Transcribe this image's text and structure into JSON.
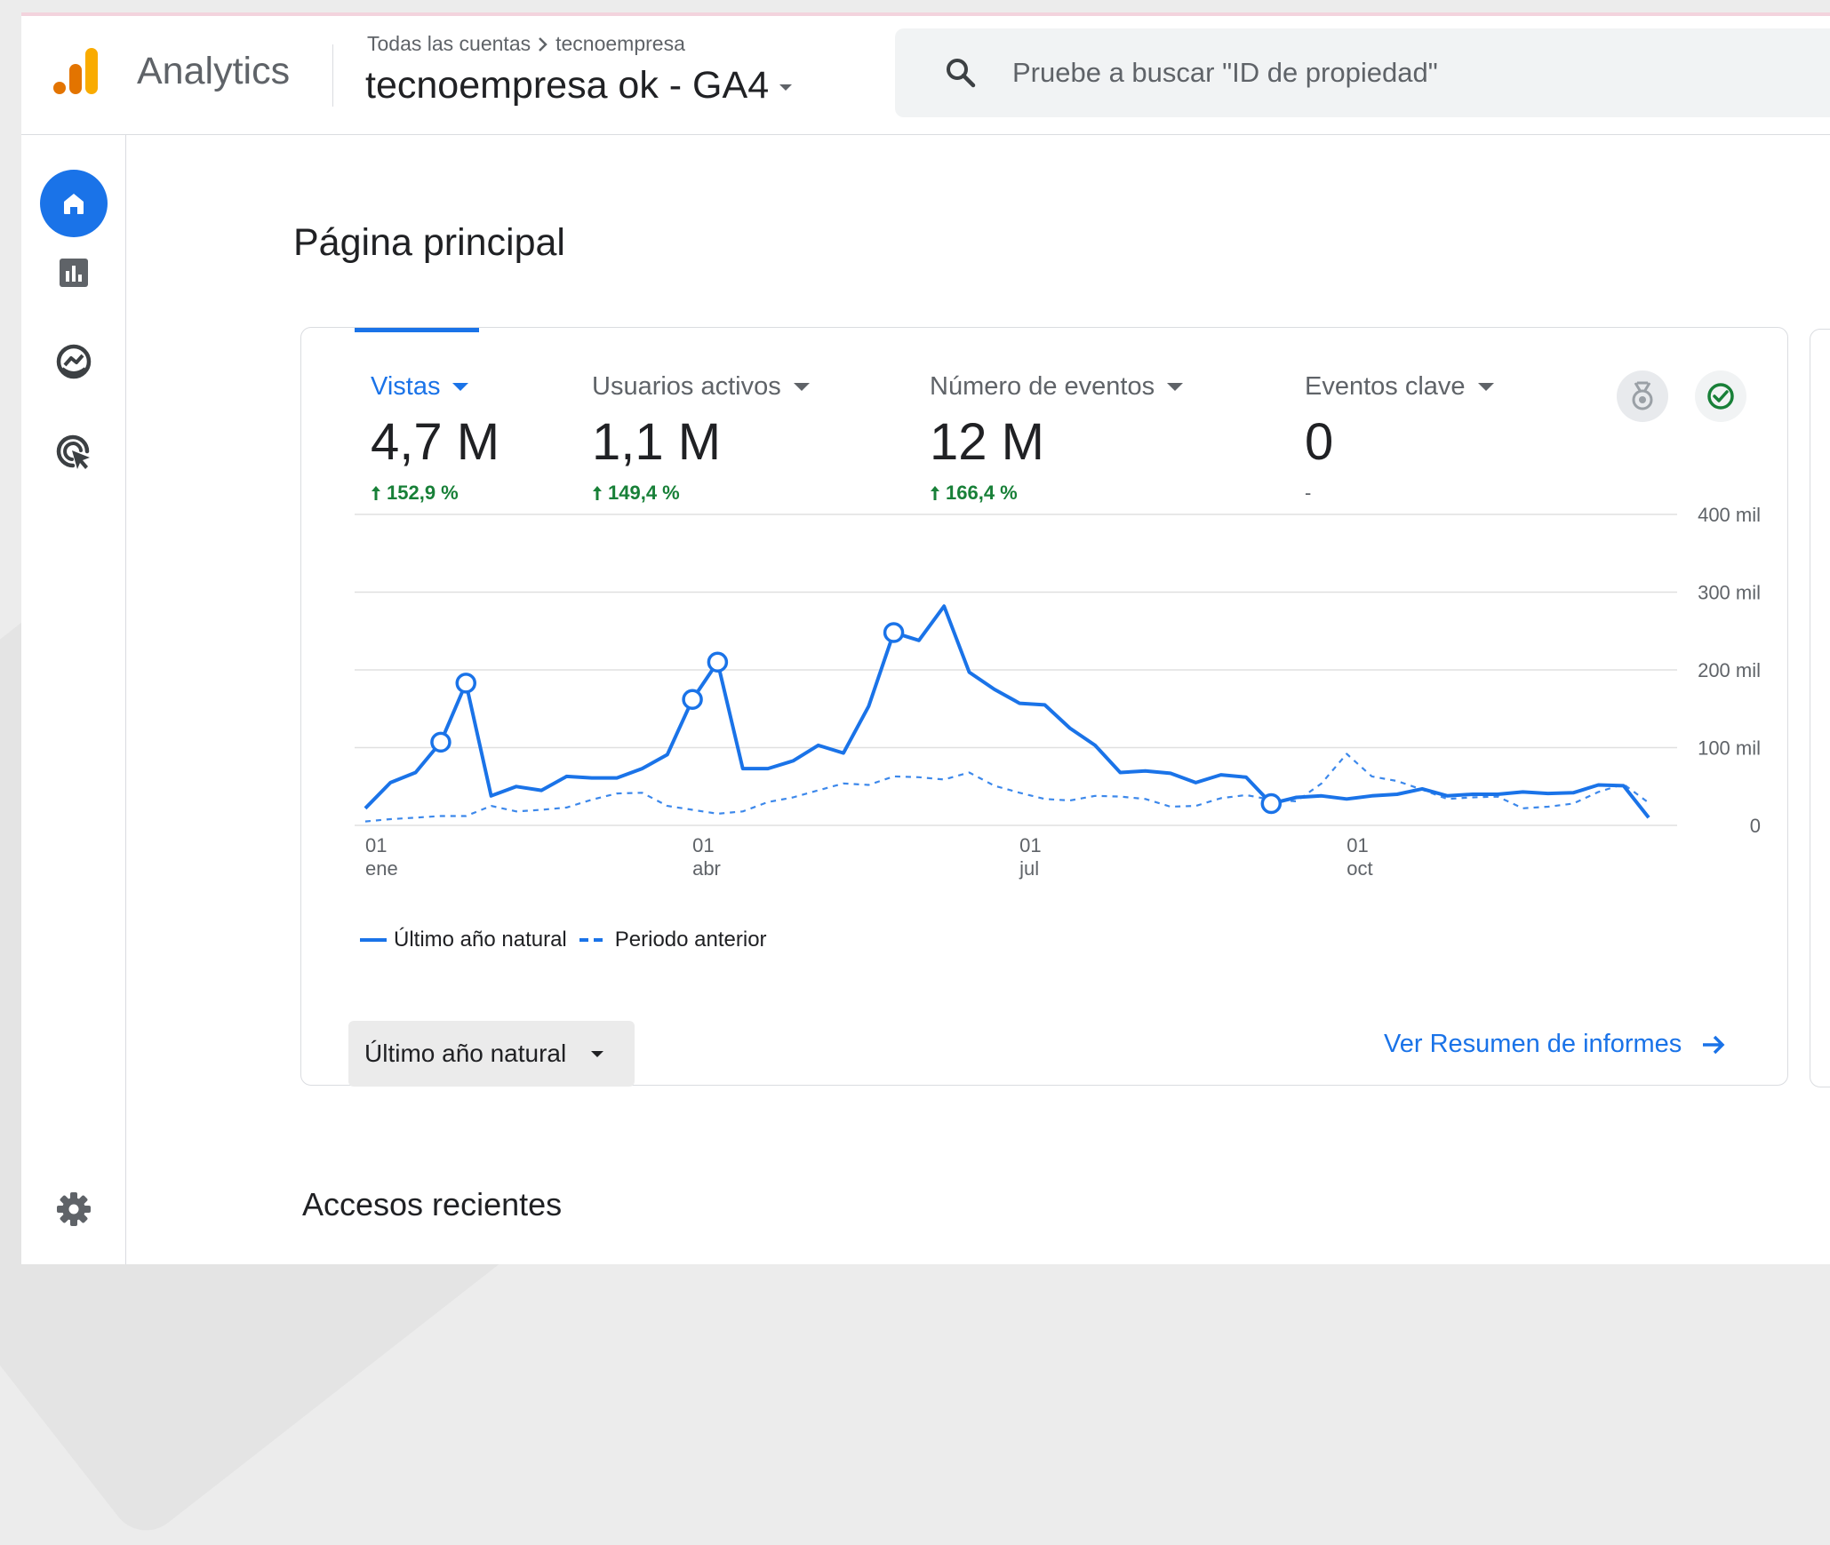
{
  "header": {
    "app_title": "Analytics",
    "breadcrumb": {
      "all_accounts": "Todas las cuentas",
      "account": "tecnoempresa"
    },
    "property": "tecnoempresa ok - GA4",
    "search_placeholder": "Pruebe a buscar \"ID de propiedad\""
  },
  "sidebar": {
    "items": [
      {
        "icon": "home-icon",
        "active": true
      },
      {
        "icon": "reports-icon"
      },
      {
        "icon": "explore-icon"
      },
      {
        "icon": "advertising-icon"
      }
    ],
    "settings_icon": "gear-icon"
  },
  "main": {
    "page_title": "Página principal",
    "metrics": [
      {
        "label": "Vistas",
        "value": "4,7 M",
        "change": "152,9 %",
        "active": true
      },
      {
        "label": "Usuarios activos",
        "value": "1,1 M",
        "change": "149,4 %"
      },
      {
        "label": "Número de eventos",
        "value": "12 M",
        "change": "166,4 %"
      },
      {
        "label": "Eventos clave",
        "value": "0",
        "change": "-"
      }
    ],
    "range_button": "Último año natural",
    "report_link": "Ver Resumen de informes",
    "recent_title": "Accesos recientes"
  },
  "colors": {
    "accent": "#1a73e8",
    "positive": "#188038",
    "insight_check": "#188038"
  },
  "chart_data": {
    "type": "line",
    "y_ticks": [
      "400 mil",
      "300 mil",
      "200 mil",
      "100 mil",
      "0"
    ],
    "ylim": [
      0,
      400000
    ],
    "x_ticks": [
      {
        "day": "01",
        "month": "ene",
        "index": 0
      },
      {
        "day": "01",
        "month": "abr",
        "index": 13
      },
      {
        "day": "01",
        "month": "jul",
        "index": 26
      },
      {
        "day": "01",
        "month": "oct",
        "index": 39
      }
    ],
    "series": [
      {
        "name": "Último año natural",
        "style": "solid",
        "values": [
          22000,
          55000,
          68000,
          107000,
          183000,
          38000,
          50000,
          45000,
          63000,
          61000,
          61000,
          73000,
          91000,
          162000,
          210000,
          73000,
          73000,
          83000,
          103000,
          93000,
          153000,
          248000,
          238000,
          282000,
          197000,
          175000,
          157000,
          155000,
          125000,
          103000,
          68000,
          70000,
          67000,
          55000,
          65000,
          62000,
          28000,
          36000,
          38000,
          34000,
          38000,
          40000,
          47000,
          38000,
          40000,
          40000,
          43000,
          41000,
          42000,
          52000,
          51000,
          10000
        ]
      },
      {
        "name": "Periodo anterior",
        "style": "dashed",
        "values": [
          5000,
          8000,
          10000,
          12000,
          12000,
          25000,
          18000,
          20000,
          23000,
          33000,
          41000,
          42000,
          25000,
          20000,
          15000,
          18000,
          30000,
          36000,
          45000,
          54000,
          52000,
          63000,
          62000,
          59000,
          68000,
          51000,
          42000,
          34000,
          32000,
          38000,
          37000,
          34000,
          24000,
          25000,
          35000,
          39000,
          33000,
          31000,
          54000,
          92000,
          63000,
          57000,
          46000,
          34000,
          36000,
          37000,
          22000,
          24000,
          28000,
          43000,
          53000,
          29000
        ]
      }
    ],
    "markers": [
      {
        "series": 0,
        "index": 3
      },
      {
        "series": 0,
        "index": 4
      },
      {
        "series": 0,
        "index": 13
      },
      {
        "series": 0,
        "index": 14
      },
      {
        "series": 0,
        "index": 21
      },
      {
        "series": 0,
        "index": 36
      }
    ],
    "legend": [
      "Último año natural",
      "Periodo anterior"
    ]
  }
}
